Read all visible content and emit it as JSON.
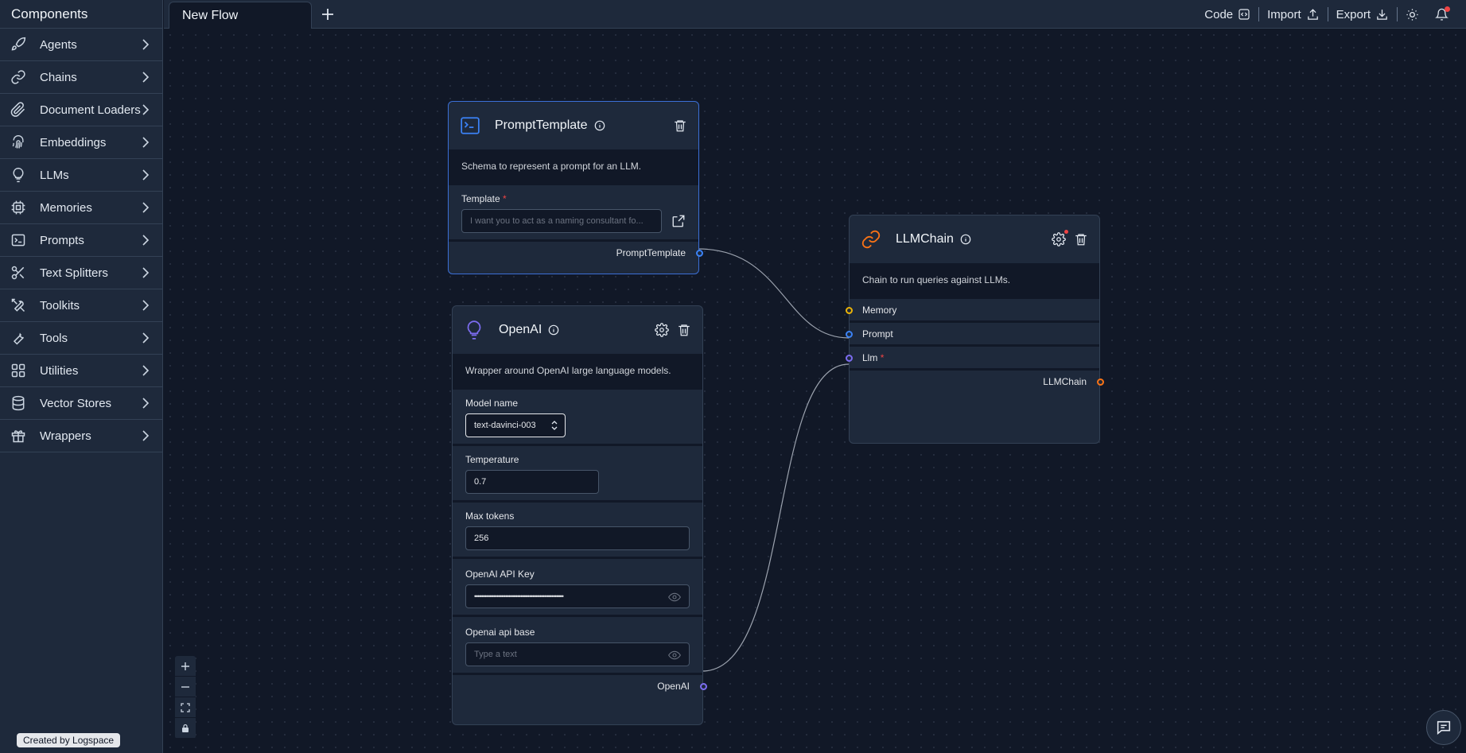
{
  "sidebar": {
    "title": "Components",
    "items": [
      {
        "label": "Agents",
        "icon": "rocket-icon"
      },
      {
        "label": "Chains",
        "icon": "link-icon"
      },
      {
        "label": "Document Loaders",
        "icon": "paperclip-icon"
      },
      {
        "label": "Embeddings",
        "icon": "fingerprint-icon"
      },
      {
        "label": "LLMs",
        "icon": "lightbulb-icon"
      },
      {
        "label": "Memories",
        "icon": "cpu-icon"
      },
      {
        "label": "Prompts",
        "icon": "terminal-icon"
      },
      {
        "label": "Text Splitters",
        "icon": "scissors-icon"
      },
      {
        "label": "Toolkits",
        "icon": "tools-icon"
      },
      {
        "label": "Tools",
        "icon": "wrench-icon"
      },
      {
        "label": "Utilities",
        "icon": "grid-icon"
      },
      {
        "label": "Vector Stores",
        "icon": "database-icon"
      },
      {
        "label": "Wrappers",
        "icon": "gift-icon"
      }
    ],
    "credit": "Created by Logspace"
  },
  "topbar": {
    "tab_label": "New Flow",
    "code_label": "Code",
    "import_label": "Import",
    "export_label": "Export"
  },
  "nodes": {
    "prompt": {
      "title": "PromptTemplate",
      "description": "Schema to represent a prompt for an LLM.",
      "template_label": "Template",
      "template_value": "I want you to act as a naming consultant fo...",
      "output_label": "PromptTemplate"
    },
    "openai": {
      "title": "OpenAI",
      "description": "Wrapper around OpenAI large language models.",
      "model_label": "Model name",
      "model_value": "text-davinci-003",
      "temperature_label": "Temperature",
      "temperature_value": "0.7",
      "max_tokens_label": "Max tokens",
      "max_tokens_value": "256",
      "api_key_label": "OpenAI API Key",
      "api_key_value": "••••••••••••••••••••••••••••••••••••••••••••••••••••",
      "api_base_label": "Openai api base",
      "api_base_placeholder": "Type a text",
      "output_label": "OpenAI"
    },
    "llmchain": {
      "title": "LLMChain",
      "description": "Chain to run queries against LLMs.",
      "memory_label": "Memory",
      "prompt_label": "Prompt",
      "llm_label": "Llm",
      "output_label": "LLMChain"
    }
  },
  "colors": {
    "accent_blue": "#3b82f6",
    "accent_orange": "#f97316",
    "accent_purple": "#7c6cf0",
    "accent_yellow": "#eab308"
  }
}
